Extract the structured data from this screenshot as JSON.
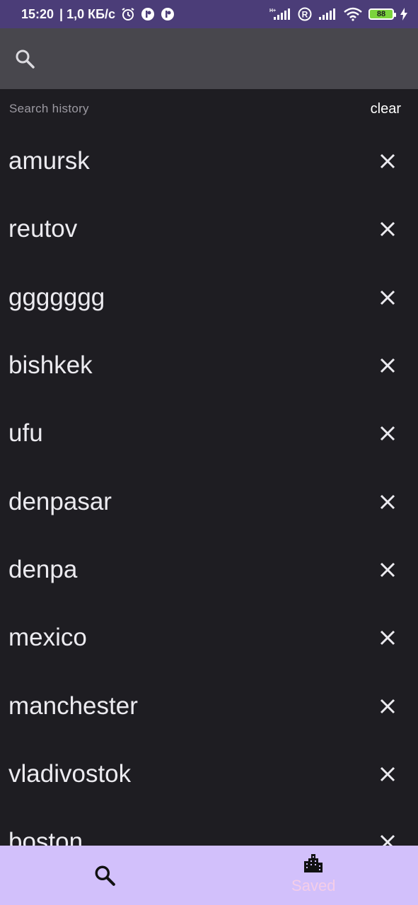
{
  "status_bar": {
    "time": "15:20",
    "speed": "| 1,0 КБ/с",
    "battery": "88"
  },
  "search": {
    "placeholder": "",
    "value": ""
  },
  "history": {
    "title": "Search history",
    "clear_label": "clear",
    "items": [
      {
        "label": "amursk"
      },
      {
        "label": "reutov"
      },
      {
        "label": "ggggggg"
      },
      {
        "label": "bishkek"
      },
      {
        "label": "ufu"
      },
      {
        "label": "denpasar"
      },
      {
        "label": "denpa"
      },
      {
        "label": "mexico"
      },
      {
        "label": "manchester"
      },
      {
        "label": "vladivostok"
      },
      {
        "label": "boston"
      }
    ]
  },
  "bottom_nav": {
    "items": [
      {
        "label": "",
        "icon": "search-icon"
      },
      {
        "label": "Saved",
        "icon": "city-icon"
      }
    ]
  },
  "colors": {
    "status_bar": "#4b3d78",
    "search_bar": "#48474d",
    "background": "#1e1d22",
    "bottom_nav": "#d2c0fb",
    "nav_label": "#f4cde8"
  }
}
